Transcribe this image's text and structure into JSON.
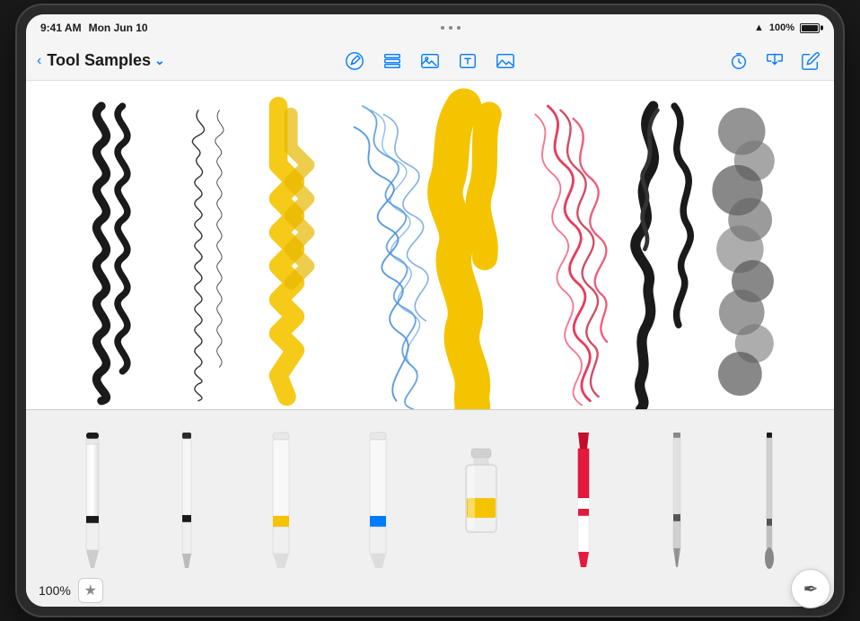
{
  "statusBar": {
    "time": "9:41 AM",
    "date": "Mon Jun 10",
    "battery": "100%",
    "dots": [
      "•",
      "•",
      "•"
    ]
  },
  "toolbar": {
    "backLabel": "‹",
    "title": "Tool Samples",
    "dropdownArrow": "⌄",
    "icons": {
      "pencil": "pencil-circle-icon",
      "layers": "layers-icon",
      "gallery": "gallery-icon",
      "text": "text-icon",
      "image": "image-icon",
      "timer": "timer-icon",
      "share": "share-icon",
      "edit": "edit-icon"
    }
  },
  "drawings": [
    {
      "id": "brush-black-squiggle",
      "label": "Black Brush Squiggle"
    },
    {
      "id": "pen-loops",
      "label": "Pen Loops"
    },
    {
      "id": "marker-yellow",
      "label": "Yellow Marker"
    },
    {
      "id": "pencil-blue-scribble",
      "label": "Blue Pencil Scribble"
    },
    {
      "id": "paint-yellow-fill",
      "label": "Yellow Paint Fill"
    },
    {
      "id": "crayon-red",
      "label": "Red Crayon"
    },
    {
      "id": "calligraphy-black",
      "label": "Black Calligraphy"
    },
    {
      "id": "ink-gray-blob",
      "label": "Gray Ink Blob"
    }
  ],
  "tools": [
    {
      "id": "pen-black",
      "label": "Pen",
      "color": "#1a1a1a",
      "type": "pen"
    },
    {
      "id": "fineliner-white",
      "label": "Fineliner",
      "color": "#1a1a1a",
      "type": "fineliner"
    },
    {
      "id": "marker-yellow",
      "label": "Marker Yellow",
      "color": "#f5c400",
      "type": "marker"
    },
    {
      "id": "marker-blue",
      "label": "Marker Blue",
      "color": "#007AFF",
      "type": "marker"
    },
    {
      "id": "paint-jar",
      "label": "Paint Jar",
      "color": "#f5c400",
      "type": "paint"
    },
    {
      "id": "crayon-red",
      "label": "Crayon Red",
      "color": "#e5193e",
      "type": "crayon"
    },
    {
      "id": "nib-pen",
      "label": "Nib Pen",
      "color": "#1a1a1a",
      "type": "nib"
    },
    {
      "id": "brush-gray",
      "label": "Brush Gray",
      "color": "#888888",
      "type": "brush"
    }
  ],
  "palette": {
    "zoom": "100%",
    "starLabel": "★",
    "nibLabel": "✒"
  }
}
